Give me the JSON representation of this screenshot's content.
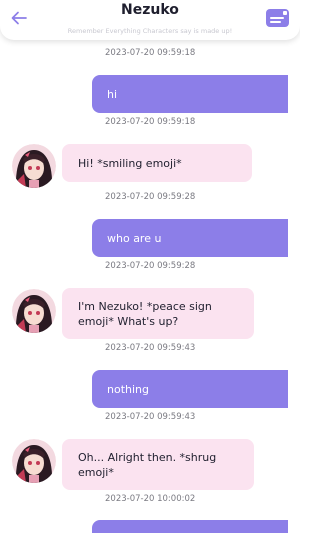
{
  "header": {
    "title": "Nezuko",
    "subtitle": "Remember Everything Characters say is made up!",
    "back_icon": "arrow-left-icon",
    "menu_icon": "chat-menu-icon"
  },
  "colors": {
    "accent": "#8c7ee8",
    "bot_bubble": "#fbe3f0",
    "timestamp": "#7a7a82"
  },
  "messages": [
    {
      "sender": "user",
      "text": null,
      "timestamp": "2023-07-20 09:59:18"
    },
    {
      "sender": "user",
      "text": "hi",
      "timestamp": "2023-07-20 09:59:18"
    },
    {
      "sender": "bot",
      "text": "Hi! *smiling emoji*",
      "timestamp": "2023-07-20 09:59:28"
    },
    {
      "sender": "user",
      "text": "who are u",
      "timestamp": "2023-07-20 09:59:28"
    },
    {
      "sender": "bot",
      "text": "I'm Nezuko! *peace sign emoji* What's up?",
      "timestamp": "2023-07-20 09:59:43"
    },
    {
      "sender": "user",
      "text": "nothing",
      "timestamp": "2023-07-20 09:59:43"
    },
    {
      "sender": "bot",
      "text": "Oh... Alright then. *shrug emoji*",
      "timestamp": "2023-07-20 10:00:02"
    },
    {
      "sender": "user",
      "text": "",
      "timestamp": ""
    }
  ]
}
